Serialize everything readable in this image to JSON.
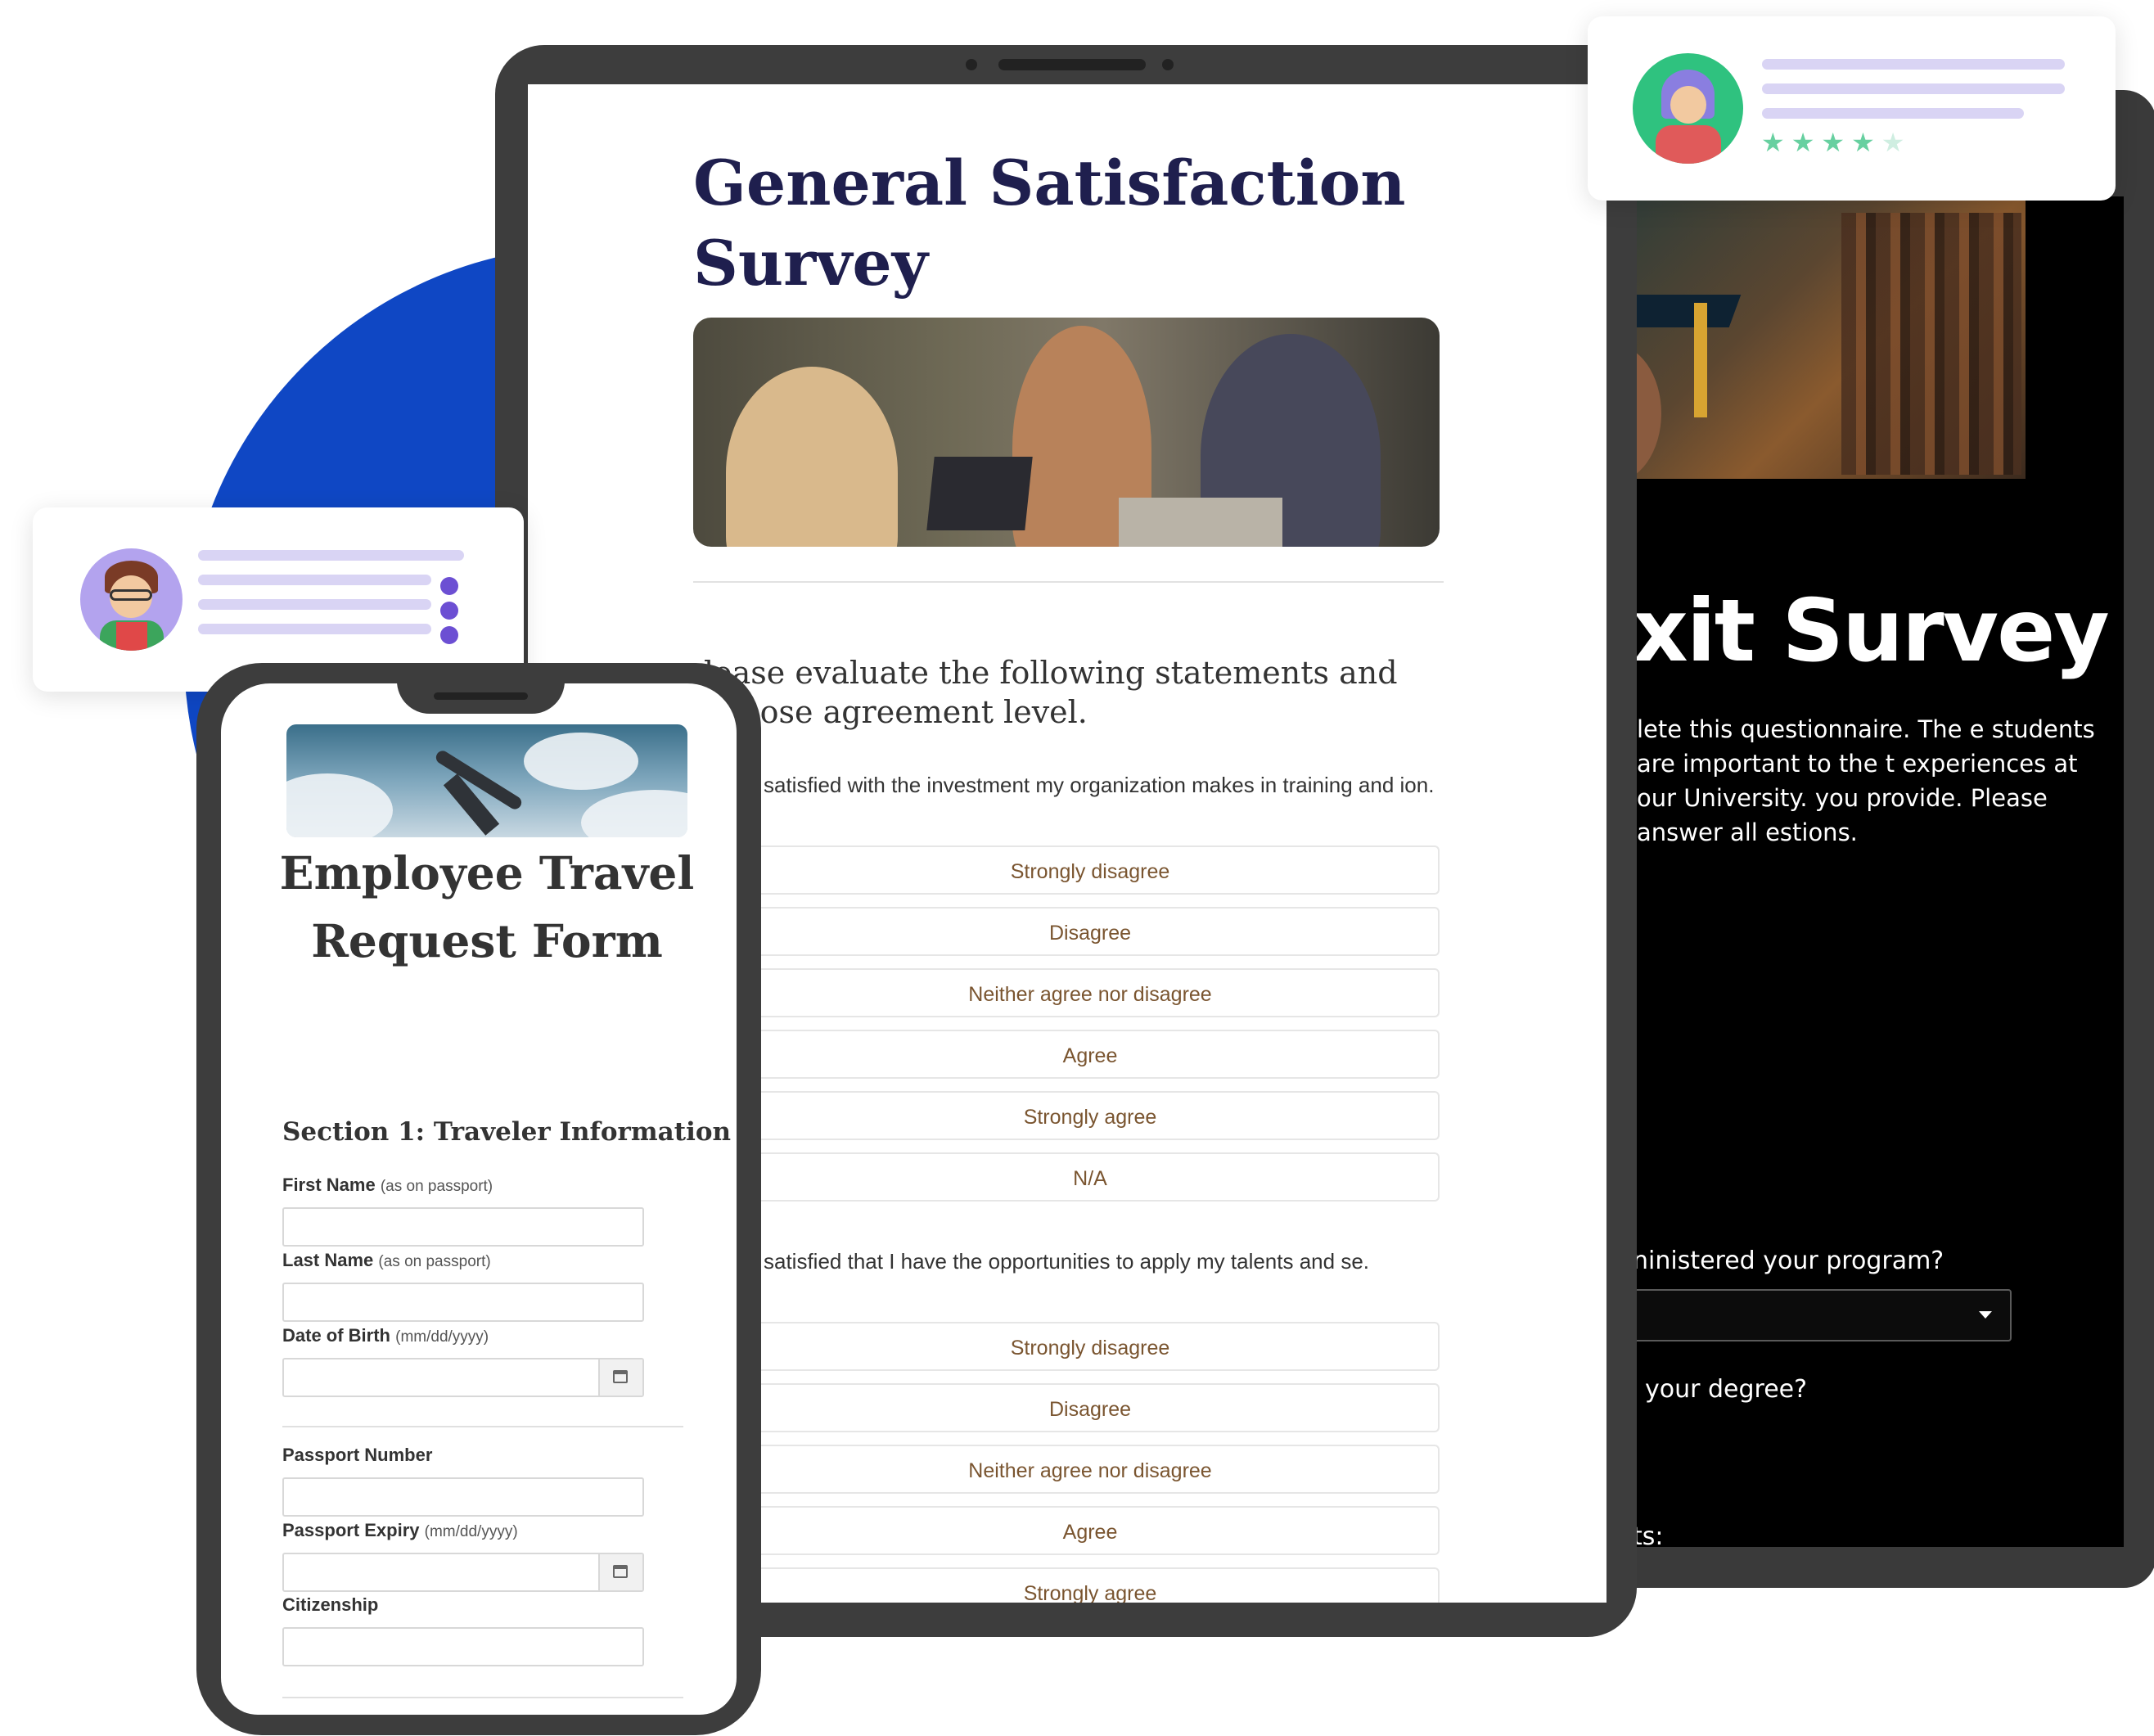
{
  "exit_survey": {
    "title": "xit Survey",
    "description": "lete this questionnaire. The e students are important to the t experiences at our University. you provide. Please answer all estions.",
    "question_program": "ninistered your program?",
    "question_degree": "your degree?",
    "question_partial": "ts:"
  },
  "general_survey": {
    "title": "General Satisfaction Survey",
    "instructions": "lease evaluate the following statements and choose agreement level.",
    "question1": "satisfied with the investment my organization makes in training and ion.",
    "question2": "satisfied that I have the opportunities to apply my talents and se.",
    "options_q1": [
      "Strongly disagree",
      "Disagree",
      "Neither agree nor disagree",
      "Agree",
      "Strongly agree",
      "N/A"
    ],
    "options_q2": [
      "Strongly disagree",
      "Disagree",
      "Neither agree nor disagree",
      "Agree",
      "Strongly agree"
    ]
  },
  "review_card": {
    "stars_filled": 4,
    "stars_total": 5,
    "star_colors": {
      "on": "#67d0a0",
      "off": "#cfeee1"
    }
  },
  "travel_form": {
    "title": "Employee Travel Request Form",
    "section_title": "Section 1: Traveler Information",
    "fields": {
      "first_name": {
        "label": "First Name",
        "hint": "(as on passport)"
      },
      "last_name": {
        "label": "Last Name",
        "hint": "(as on passport)"
      },
      "dob": {
        "label": "Date of Birth",
        "hint": "(mm/dd/yyyy)"
      },
      "passport_number": {
        "label": "Passport Number"
      },
      "passport_expiry": {
        "label": "Passport Expiry",
        "hint": "(mm/dd/yyyy)"
      },
      "citizenship": {
        "label": "Citizenship"
      }
    }
  },
  "colors": {
    "brand_blue": "#0f47c4",
    "title_navy": "#1f1f4e",
    "option_text": "#7a5530",
    "accent_purple": "#6c4fd3"
  }
}
